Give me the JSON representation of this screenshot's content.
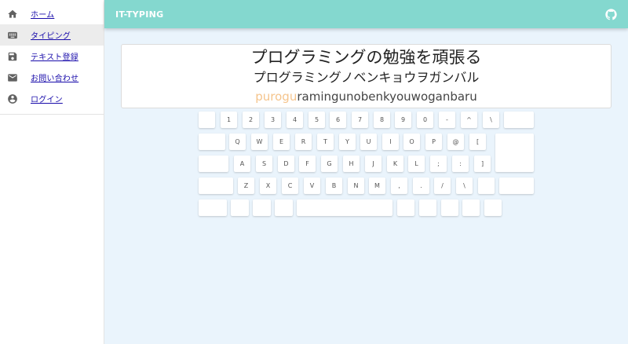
{
  "sidebar": {
    "items": [
      {
        "label": "ホーム",
        "icon": "home-icon"
      },
      {
        "label": "タイピング",
        "icon": "keyboard-icon"
      },
      {
        "label": "テキスト登録",
        "icon": "save-icon"
      },
      {
        "label": "お問い合わせ",
        "icon": "mail-icon"
      },
      {
        "label": "ログイン",
        "icon": "account-icon"
      }
    ]
  },
  "header": {
    "title": "IT-TYPING",
    "github_icon": "github-icon"
  },
  "question": {
    "japanese": "プログラミングの勉強を頑張る",
    "kana": "プログラミングノベンキョウヲガンバル",
    "romaji_typed": "purogu",
    "romaji_remaining": "ramingunobenkyouwoganbaru"
  },
  "keyboard": {
    "rows": [
      [
        "",
        "1",
        "2",
        "3",
        "4",
        "5",
        "6",
        "7",
        "8",
        "9",
        "0",
        "-",
        "^",
        "\\",
        ""
      ],
      [
        "",
        "Q",
        "W",
        "E",
        "R",
        "T",
        "Y",
        "U",
        "I",
        "O",
        "P",
        "@",
        "[",
        ""
      ],
      [
        "",
        "A",
        "S",
        "D",
        "F",
        "G",
        "H",
        "J",
        "K",
        "L",
        ";",
        ":",
        "]"
      ],
      [
        "",
        "Z",
        "X",
        "C",
        "V",
        "B",
        "N",
        "M",
        ",",
        ".",
        "/",
        "\\",
        "",
        ""
      ],
      [
        "",
        "",
        "",
        "",
        "",
        "",
        "",
        "",
        "",
        ""
      ]
    ]
  },
  "colors": {
    "header_bg": "#84d8cf",
    "typed_text": "#f5c48c",
    "page_bg": "#eaf4fc"
  }
}
